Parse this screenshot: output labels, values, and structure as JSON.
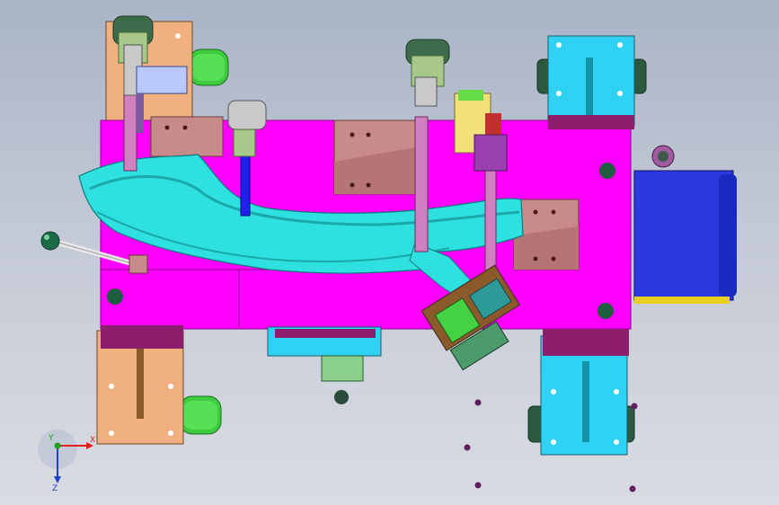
{
  "viewport": {
    "background_top": "#a9b4c7",
    "background_bottom": "#d9dce2"
  },
  "triad": {
    "x_label": "X",
    "y_label": "Y",
    "z_label": "Z",
    "x_color": "#e02020",
    "y_color": "#20a020",
    "z_color": "#2040d0"
  },
  "palette": {
    "base_plate": "#ff00ff",
    "clamp_body": "#c98a8a",
    "locator_block": "#2fd2f2",
    "foot_pad": "#f0b080",
    "caster": "#44cc44",
    "cylinder": "#2020ee",
    "part_surface": "#2fe0e0",
    "clamp_arm": "#d080c0",
    "pin": "#5f1f5f",
    "handle": "#1a6b45"
  },
  "icons": {
    "caster": "caster-wheel-icon",
    "clamp": "toggle-clamp-icon",
    "cylinder": "air-cylinder-icon",
    "handle": "lever-handle-icon"
  }
}
